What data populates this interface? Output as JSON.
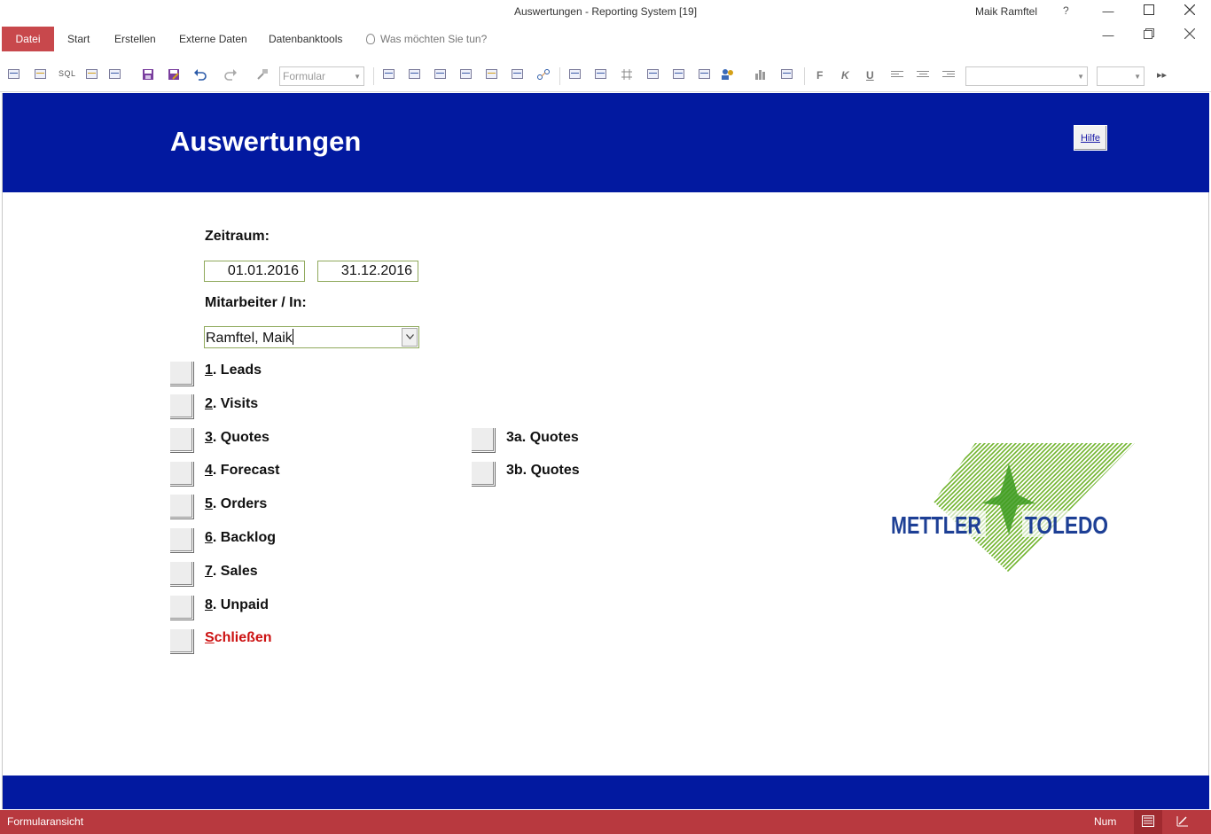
{
  "window": {
    "title": "Auswertungen - Reporting System [19]",
    "user": "Maik Ramftel",
    "help": "?"
  },
  "ribbon": {
    "tabs": [
      "Datei",
      "Start",
      "Erstellen",
      "Externe Daten",
      "Datenbanktools"
    ],
    "tellme": "Was möchten Sie tun?"
  },
  "toolbar": {
    "sql": "SQL",
    "object_combo": "Formular",
    "bold": "F",
    "italic": "K",
    "underline": "U"
  },
  "form": {
    "title": "Auswertungen",
    "help_button": "Hilfe",
    "zeitraum_label": "Zeitraum:",
    "date_from": "01.01.2016",
    "date_to": "31.12.2016",
    "mitarbeiter_label": "Mitarbeiter / In:",
    "mitarbeiter_value": "Ramftel, Maik",
    "buttons": [
      {
        "acc": "1",
        "text": ". Leads"
      },
      {
        "acc": "2",
        "text": ". Visits"
      },
      {
        "acc": "3",
        "text": ". Quotes"
      },
      {
        "acc": "4",
        "text": ". Forecast"
      },
      {
        "acc": "5",
        "text": ". Orders"
      },
      {
        "acc": "6",
        "text": ". Backlog"
      },
      {
        "acc": "7",
        "text": ". Sales"
      },
      {
        "acc": "8",
        "text": ". Unpaid"
      }
    ],
    "buttons_right": [
      "3a. Quotes",
      "3b. Quotes"
    ],
    "close_acc": "S",
    "close_text": "chließen",
    "logo": {
      "left": "METTLER",
      "right": "TOLEDO"
    }
  },
  "colors": {
    "header_blue": "#0219a0",
    "status_red": "#b8393f",
    "close_red": "#cc1111"
  },
  "status": {
    "left": "Formularansicht",
    "num": "Num"
  }
}
